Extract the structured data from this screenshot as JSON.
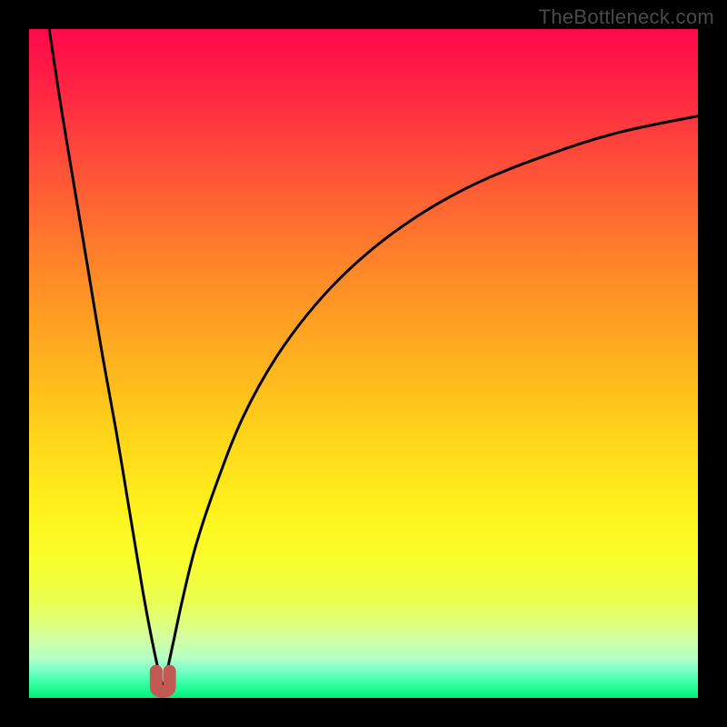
{
  "watermark": "TheBottleneck.com",
  "chart_data": {
    "type": "line",
    "title": "",
    "xlabel": "",
    "ylabel": "",
    "xlim": [
      0,
      100
    ],
    "ylim": [
      0,
      100
    ],
    "x_optimum": 20,
    "series": [
      {
        "name": "bottleneck-curve",
        "x": [
          3,
          5,
          7,
          9,
          11,
          13,
          15,
          17,
          18.5,
          19.5,
          20,
          20.5,
          21.5,
          23,
          25,
          28,
          32,
          37,
          43,
          50,
          58,
          67,
          77,
          88,
          100
        ],
        "y": [
          100,
          87,
          75,
          63,
          51,
          40,
          28,
          16,
          8,
          3.5,
          2,
          3.5,
          8,
          15,
          23,
          32,
          42,
          51,
          59,
          66,
          72,
          77,
          81,
          84.5,
          87
        ]
      }
    ],
    "marker": {
      "name": "optimum-marker",
      "x_range": [
        19,
        21
      ],
      "y_range": [
        0,
        4
      ],
      "color": "#c05a52"
    },
    "gradient_stops": [
      {
        "pos": 0.0,
        "color": "#ff0a4a"
      },
      {
        "pos": 0.25,
        "color": "#ff6034"
      },
      {
        "pos": 0.6,
        "color": "#ffd21a"
      },
      {
        "pos": 0.85,
        "color": "#eaff55"
      },
      {
        "pos": 1.0,
        "color": "#00f07a"
      }
    ]
  }
}
